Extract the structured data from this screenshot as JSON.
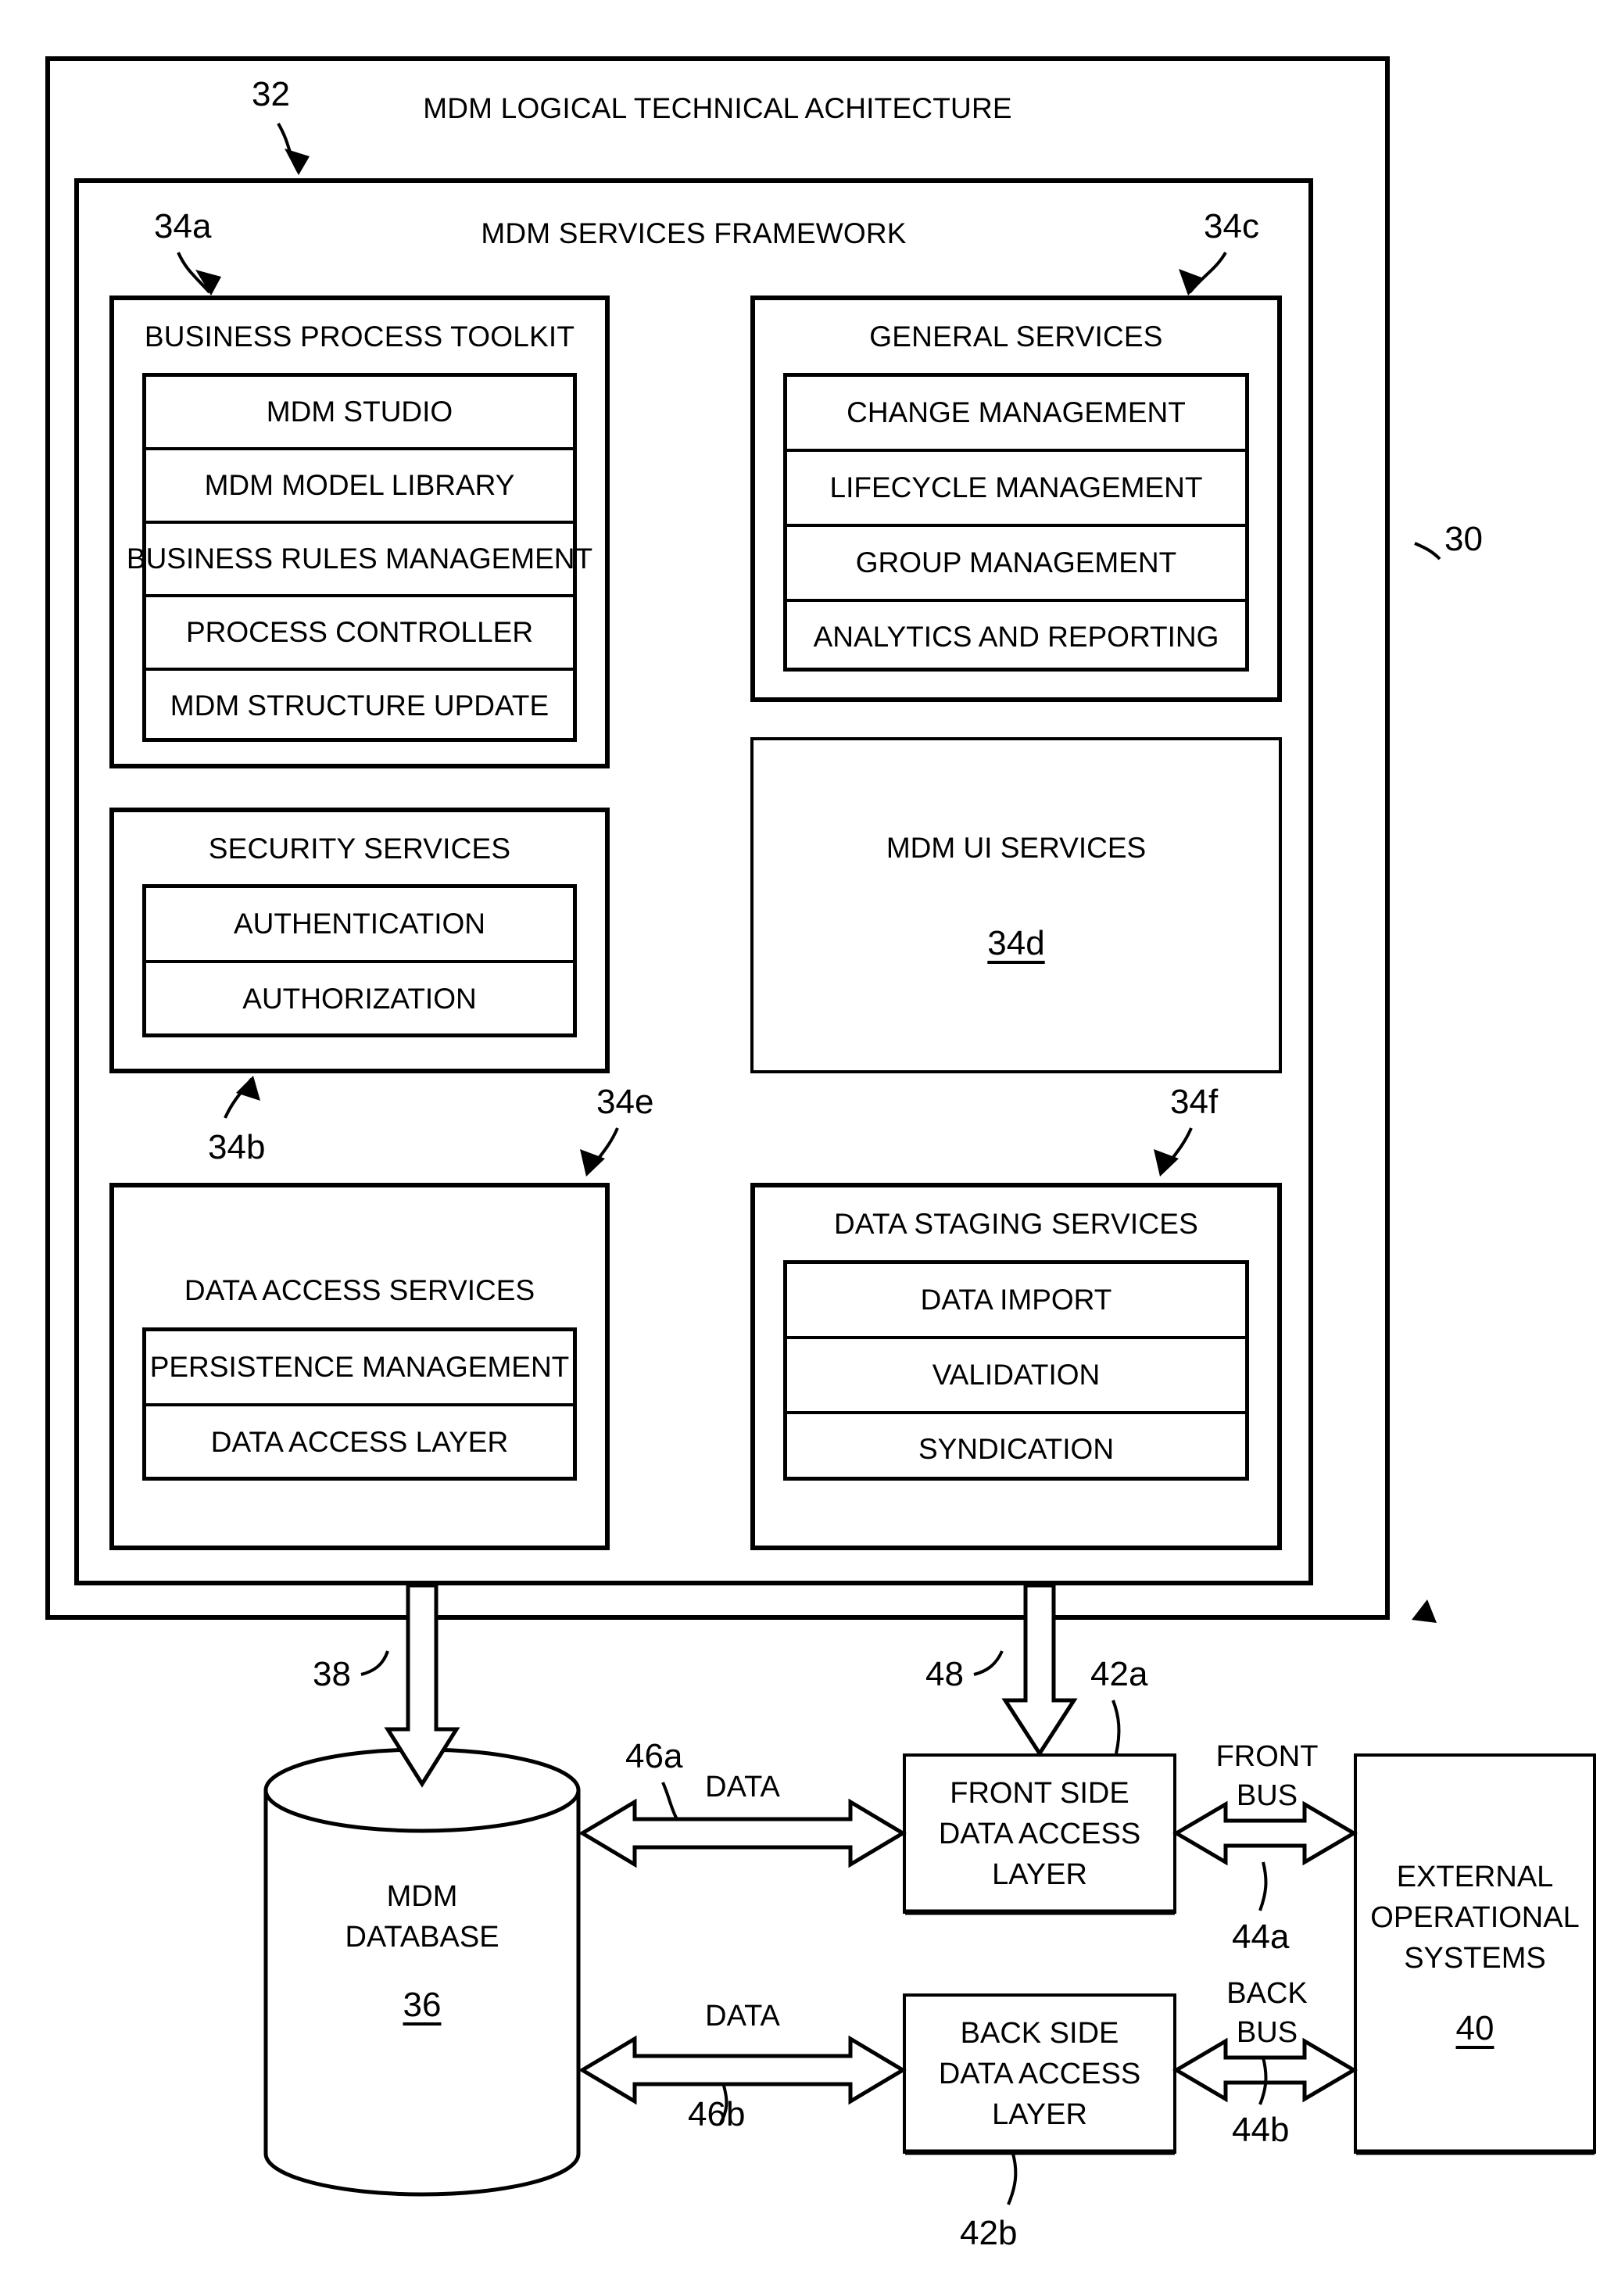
{
  "figure": {
    "outer_label": "30",
    "outer_title": "MDM LOGICAL TECHNICAL ACHITECTURE",
    "outer_title_ref": "32",
    "framework_title": "MDM SERVICES FRAMEWORK"
  },
  "panels": {
    "business_process_toolkit": {
      "ref": "34a",
      "title": "BUSINESS PROCESS TOOLKIT",
      "items": [
        "MDM STUDIO",
        "MDM MODEL LIBRARY",
        "BUSINESS RULES MANAGEMENT",
        "PROCESS CONTROLLER",
        "MDM STRUCTURE UPDATE"
      ]
    },
    "general_services": {
      "ref": "34c",
      "title": "GENERAL SERVICES",
      "items": [
        "CHANGE MANAGEMENT",
        "LIFECYCLE MANAGEMENT",
        "GROUP MANAGEMENT",
        "ANALYTICS AND REPORTING"
      ]
    },
    "security_services": {
      "ref": "34b",
      "title": "SECURITY SERVICES",
      "items": [
        "AUTHENTICATION",
        "AUTHORIZATION"
      ]
    },
    "mdm_ui_services": {
      "ref": "34d",
      "title": "MDM UI SERVICES"
    },
    "data_access_services": {
      "ref": "34e",
      "title": "DATA ACCESS SERVICES",
      "items": [
        "PERSISTENCE MANAGEMENT",
        "DATA ACCESS LAYER"
      ]
    },
    "data_staging_services": {
      "ref": "34f",
      "title": "DATA STAGING SERVICES",
      "items": [
        "DATA IMPORT",
        "VALIDATION",
        "SYNDICATION"
      ]
    }
  },
  "bottom": {
    "database": {
      "line1": "MDM",
      "line2": "DATABASE",
      "ref": "36"
    },
    "front_side": {
      "line1": "FRONT SIDE",
      "line2": "DATA ACCESS",
      "line3": "LAYER",
      "ref": "42a"
    },
    "back_side": {
      "line1": "BACK SIDE",
      "line2": "DATA ACCESS",
      "line3": "LAYER",
      "ref": "42b"
    },
    "external": {
      "line1": "EXTERNAL",
      "line2": "OPERATIONAL",
      "line3": "SYSTEMS",
      "ref": "40"
    }
  },
  "connectors": {
    "db_vertical_ref": "38",
    "front_vertical_ref": "48",
    "data_top_label": "DATA",
    "data_top_ref": "46a",
    "data_bottom_label": "DATA",
    "data_bottom_ref": "46b",
    "front_bus_line1": "FRONT",
    "front_bus_line2": "BUS",
    "front_bus_ref": "44a",
    "back_bus_line1": "BACK",
    "back_bus_line2": "BUS",
    "back_bus_ref": "44b"
  },
  "colors": {
    "ink": "#000000",
    "paper": "#ffffff"
  }
}
